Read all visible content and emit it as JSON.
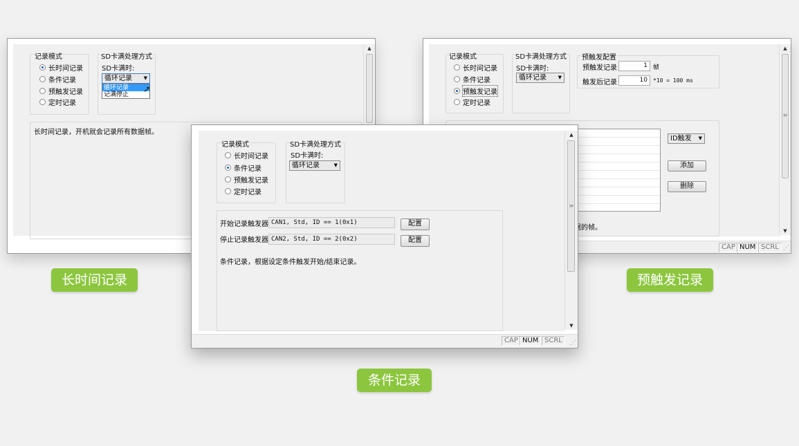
{
  "common": {
    "record_mode_title": "记录模式",
    "sd_full_title": "SD卡满处理方式",
    "sd_full_label": "SD卡满时:",
    "modes": [
      "长时间记录",
      "条件记录",
      "预触发记录",
      "定时记录"
    ],
    "status": {
      "cap": "CAP",
      "num": "NUM",
      "scrl": "SCRL"
    },
    "scroll_up": "▲",
    "scroll_down": "▼",
    "scroll_grip": "≡",
    "resize": "⋰"
  },
  "window_long": {
    "caption": "长时间记录",
    "selected_mode": "长时间记录",
    "sd_full_value": "循环记录",
    "dropdown_options": [
      "循环记录",
      "记满停止"
    ],
    "description": "长时间记录，开机就会记录所有数据帧。"
  },
  "window_pretrigger": {
    "caption": "预触发记录",
    "selected_mode": "预触发记录",
    "sd_full_value": "循环记录",
    "config_title": "预触发配置",
    "pre_label": "预触发记录",
    "pre_value": "1",
    "pre_unit": "帧",
    "post_label": "触发后记录",
    "post_value": "10",
    "post_unit": "*10 = 100 ms",
    "trigger_combo": "ID触发",
    "add_button": "添加",
    "delete_button": "删除",
    "description_tail": "据的帧。"
  },
  "window_condition": {
    "caption": "条件记录",
    "selected_mode": "条件记录",
    "sd_full_value": "循环记录",
    "start_label": "开始记录触发器",
    "start_value": "CAN1, Std, ID == 1(0x1)",
    "stop_label": "停止记录触发器",
    "stop_value": "CAN2, Std, ID == 2(0x2)",
    "config_button": "配置",
    "description": "条件记录，根据设定条件触发开始/结束记录。"
  }
}
